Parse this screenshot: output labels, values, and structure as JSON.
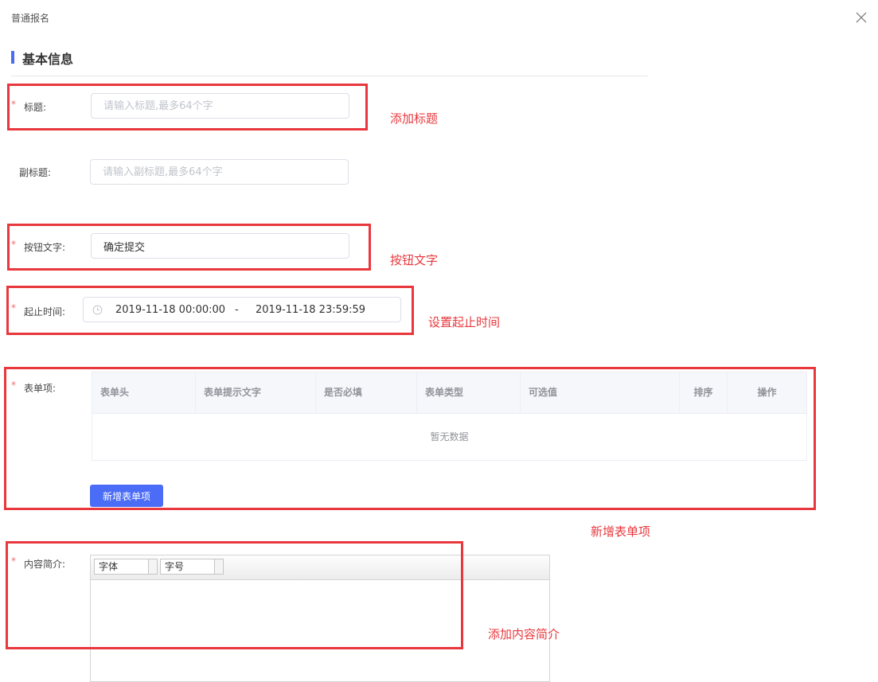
{
  "dialog": {
    "title": "普通报名"
  },
  "section": {
    "title": "基本信息"
  },
  "form": {
    "required_mark": "*",
    "title": {
      "label": "标题:",
      "placeholder": "请输入标题,最多64个字",
      "value": ""
    },
    "subtitle": {
      "label": "副标题:",
      "placeholder": "请输入副标题,最多64个字",
      "value": ""
    },
    "button_text": {
      "label": "按钮文字:",
      "value": "确定提交"
    },
    "time_range": {
      "label": "起止时间:",
      "start": "2019-11-18 00:00:00",
      "separator": "-",
      "end": "2019-11-18 23:59:59"
    },
    "form_items": {
      "label": "表单项:",
      "columns": [
        "表单头",
        "表单提示文字",
        "是否必填",
        "表单类型",
        "可选值",
        "排序",
        "操作"
      ],
      "empty_text": "暂无数据",
      "add_button": "新增表单项"
    },
    "content_intro": {
      "label": "内容简介:",
      "font_family": "字体",
      "font_size": "字号"
    }
  },
  "annotations": {
    "title": "添加标题",
    "button_text": "按钮文字",
    "time_range": "设置起止时间",
    "form_items": "新增表单项",
    "content_intro": "添加内容简介"
  },
  "colors": {
    "accent": "#4a6cf7",
    "required": "#f56c6c",
    "annotation": "#e8383d"
  },
  "icons": {
    "close": "close-icon",
    "clock": "clock-icon"
  }
}
